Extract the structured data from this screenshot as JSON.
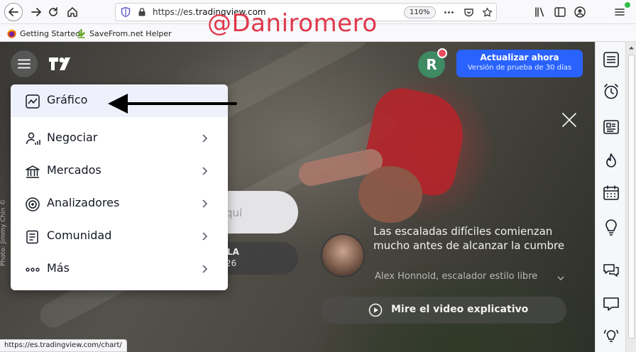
{
  "browser": {
    "url_prefix": "https://es.",
    "url_host": "tradingview.com",
    "zoom": "110%",
    "bookmarks": [
      "Getting Started",
      "SaveFrom.net Helper"
    ]
  },
  "watermark": "@Daniromero",
  "header": {
    "avatar_letter": "R",
    "upgrade_title": "Actualizar ahora",
    "upgrade_subtitle": "Versión de prueba de 30 días"
  },
  "menu": {
    "items": [
      {
        "label": "Gráfico",
        "icon": "chart-line-icon",
        "active": true,
        "has_chevron": false
      },
      {
        "label": "Negociar",
        "icon": "trader-icon",
        "active": false,
        "has_chevron": true
      },
      {
        "label": "Mercados",
        "icon": "bank-icon",
        "active": false,
        "has_chevron": true
      },
      {
        "label": "Analizadores",
        "icon": "target-icon",
        "active": false,
        "has_chevron": true
      },
      {
        "label": "Comunidad",
        "icon": "document-icon",
        "active": false,
        "has_chevron": true
      },
      {
        "label": "Más",
        "icon": "dots-icon",
        "active": false,
        "has_chevron": true
      }
    ]
  },
  "hero": {
    "search_ghost": "quí",
    "ticker_symbol": "LA",
    "ticker_value": ".26",
    "quote": "Las escaladas difíciles comienzan mucho antes de alcanzar la cumbre",
    "author": "Alex Honnold, escalador estilo libre",
    "video_label": "Mire el video explicativo",
    "photo_credit": "Photo: Jimmy Chin ©"
  },
  "status_bar": "https://es.tradingview.com/chart/",
  "colors": {
    "accent": "#2962ff",
    "avatar_bg": "#3e8a63",
    "notification": "#e94a5f",
    "watermark": "#e0374a"
  }
}
